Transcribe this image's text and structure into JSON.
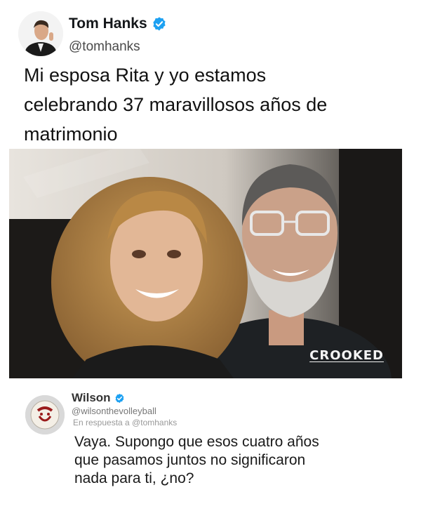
{
  "tweet": {
    "display_name": "Tom Hanks",
    "handle": "@tomhanks",
    "text": "Mi esposa Rita y yo estamos\ncelebrando 37 maravillosos años  de\nmatrimonio",
    "photo_watermark": "CROOKED",
    "verified_color": "#1da1f2"
  },
  "reply": {
    "display_name": "Wilson",
    "handle": "@wilsonthevolleyball",
    "context": "En respuesta a @tomhanks",
    "text": "Vaya. Supongo que esos cuatro años\nque pasamos juntos no significaron\nnada para ti, ¿no?"
  }
}
